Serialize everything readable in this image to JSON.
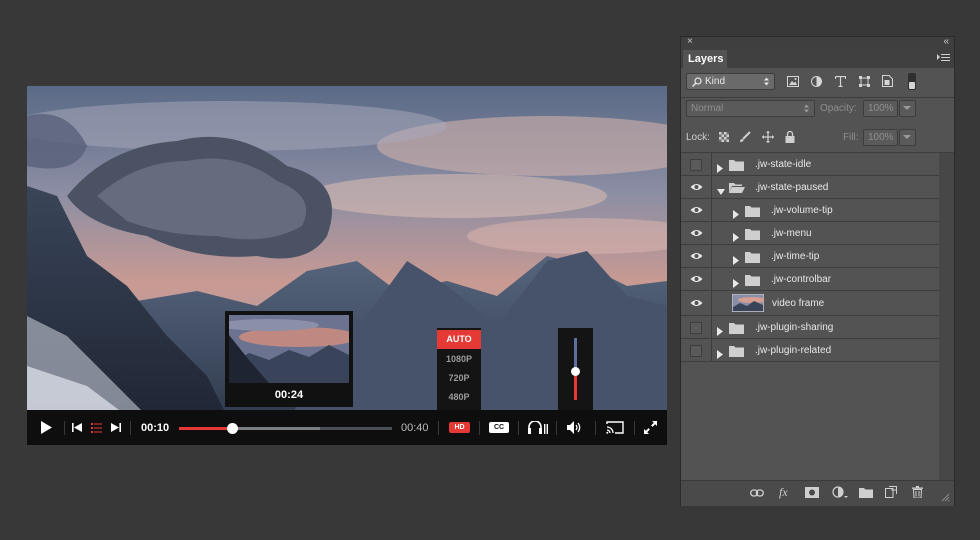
{
  "player": {
    "current_time": "00:10",
    "duration": "00:40",
    "progress_fraction": 0.25,
    "buffered_fraction": 0.66,
    "hd_label": "HD",
    "cc_label": "CC",
    "time_tip": "00:24",
    "quality_options": [
      "AUTO",
      "1080P",
      "720P",
      "480P"
    ],
    "quality_selected": "AUTO",
    "volume_fraction": 0.55,
    "accent_color": "#e53935",
    "icons": [
      "play-icon",
      "previous-icon",
      "playlist-icon",
      "next-icon",
      "headphones-icon",
      "volume-icon",
      "cast-icon",
      "fullscreen-icon"
    ]
  },
  "layers_panel": {
    "tab_label": "Layers",
    "filter_kind": "Kind",
    "blend_mode": "Normal",
    "opacity_label": "Opacity:",
    "opacity_value": "100%",
    "lock_label": "Lock:",
    "fill_label": "Fill:",
    "fill_value": "100%",
    "layers": [
      {
        "name": ".jw-state-idle",
        "visible": false,
        "expanded": false,
        "indent": 0
      },
      {
        "name": ".jw-state-paused",
        "visible": true,
        "expanded": true,
        "indent": 0
      },
      {
        "name": ".jw-volume-tip",
        "visible": true,
        "expanded": false,
        "indent": 1
      },
      {
        "name": ".jw-menu",
        "visible": true,
        "expanded": false,
        "indent": 1
      },
      {
        "name": ".jw-time-tip",
        "visible": true,
        "expanded": false,
        "indent": 1
      },
      {
        "name": ".jw-controlbar",
        "visible": true,
        "expanded": false,
        "indent": 1
      },
      {
        "name": "video frame",
        "visible": true,
        "expanded": false,
        "indent": 1
      },
      {
        "name": ".jw-plugin-sharing",
        "visible": false,
        "expanded": false,
        "indent": 0
      },
      {
        "name": ".jw-plugin-related",
        "visible": false,
        "expanded": false,
        "indent": 0
      }
    ]
  }
}
